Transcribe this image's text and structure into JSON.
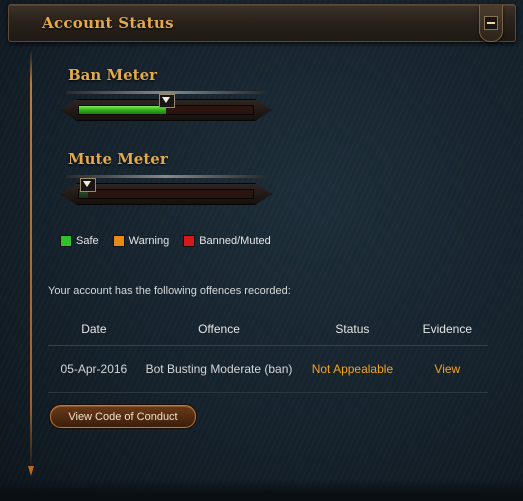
{
  "header": {
    "title": "Account Status"
  },
  "ban_meter": {
    "label": "Ban Meter",
    "level": 0.5
  },
  "mute_meter": {
    "label": "Mute Meter",
    "level": 0.05
  },
  "legend": [
    {
      "label": "Safe",
      "color": "#2fc22a"
    },
    {
      "label": "Warning",
      "color": "#e58a16"
    },
    {
      "label": "Banned/Muted",
      "color": "#d11a1a"
    }
  ],
  "intro": "Your account has the following offences recorded:",
  "table": {
    "headers": [
      "Date",
      "Offence",
      "Status",
      "Evidence"
    ],
    "rows": [
      {
        "date": "05-Apr-2016",
        "offence": "Bot Busting Moderate (ban)",
        "status": "Not Appealable",
        "evidence": "View"
      }
    ]
  },
  "coc_button": "View Code of Conduct",
  "colors": {
    "accent": "#e3a94a",
    "status": "#f6a21f"
  }
}
